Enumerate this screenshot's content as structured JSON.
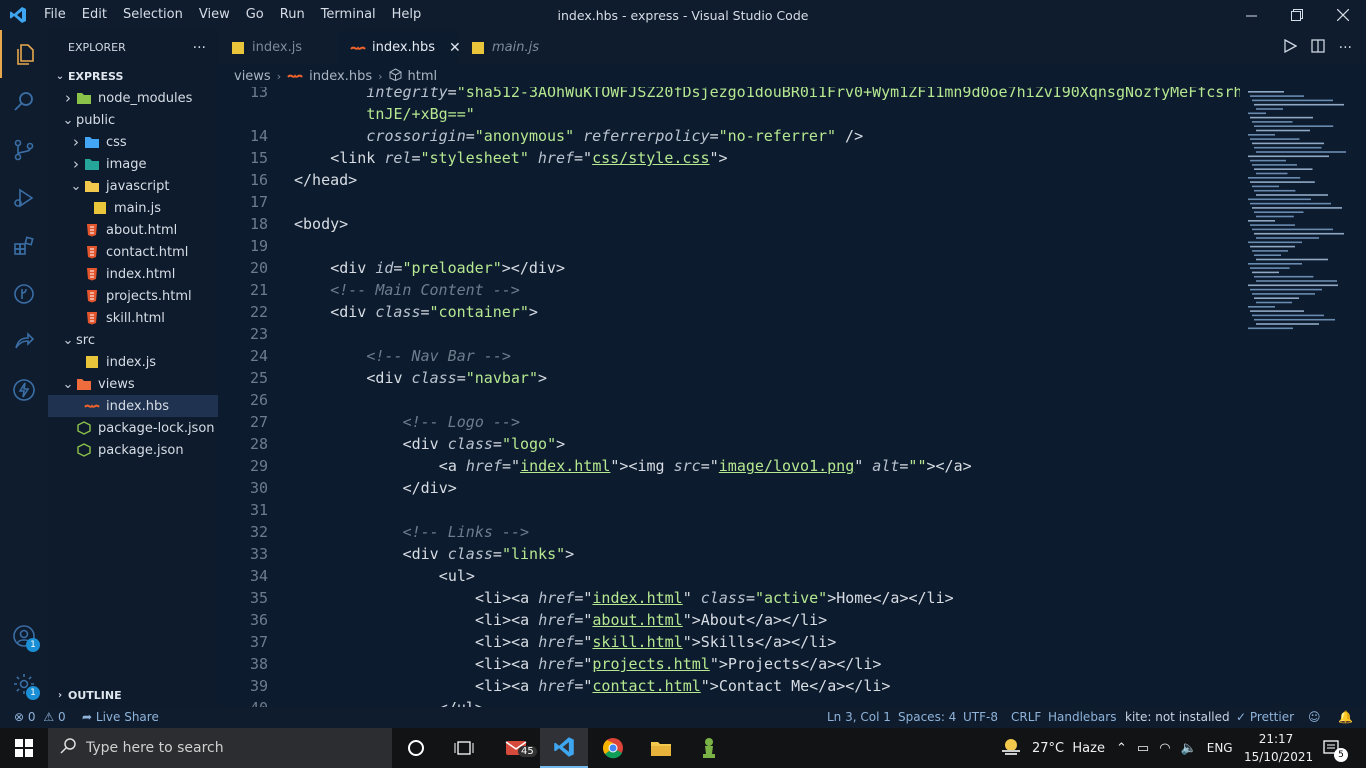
{
  "window": {
    "title": "index.hbs - express - Visual Studio Code",
    "menu": [
      "File",
      "Edit",
      "Selection",
      "View",
      "Go",
      "Run",
      "Terminal",
      "Help"
    ]
  },
  "sidebar": {
    "header": "EXPLORER",
    "more": "···",
    "root": "EXPRESS",
    "outline": "OUTLINE",
    "tree": [
      {
        "label": "node_modules",
        "depth": 1,
        "chevron": "right",
        "icon": "folder-node-icon"
      },
      {
        "label": "public",
        "depth": 1,
        "chevron": "down",
        "icon": "none"
      },
      {
        "label": "css",
        "depth": 2,
        "chevron": "right",
        "icon": "folder-css-icon"
      },
      {
        "label": "image",
        "depth": 2,
        "chevron": "right",
        "icon": "folder-image-icon"
      },
      {
        "label": "javascript",
        "depth": 2,
        "chevron": "down",
        "icon": "folder-js-icon"
      },
      {
        "label": "main.js",
        "depth": 3,
        "chevron": "none",
        "icon": "js-file-icon"
      },
      {
        "label": "about.html",
        "depth": 2,
        "chevron": "none",
        "icon": "html-file-icon"
      },
      {
        "label": "contact.html",
        "depth": 2,
        "chevron": "none",
        "icon": "html-file-icon"
      },
      {
        "label": "index.html",
        "depth": 2,
        "chevron": "none",
        "icon": "html-file-icon"
      },
      {
        "label": "projects.html",
        "depth": 2,
        "chevron": "none",
        "icon": "html-file-icon"
      },
      {
        "label": "skill.html",
        "depth": 2,
        "chevron": "none",
        "icon": "html-file-icon"
      },
      {
        "label": "src",
        "depth": 1,
        "chevron": "down",
        "icon": "none"
      },
      {
        "label": "index.js",
        "depth": 2,
        "chevron": "none",
        "icon": "js-file-icon"
      },
      {
        "label": "views",
        "depth": 1,
        "chevron": "down",
        "icon": "folder-views-icon"
      },
      {
        "label": "index.hbs",
        "depth": 2,
        "chevron": "none",
        "icon": "hbs-file-icon",
        "selected": true
      },
      {
        "label": "package-lock.json",
        "depth": 1,
        "chevron": "none",
        "icon": "node-file-icon"
      },
      {
        "label": "package.json",
        "depth": 1,
        "chevron": "none",
        "icon": "node-file-icon"
      }
    ]
  },
  "tabs": [
    {
      "label": "index.js",
      "icon": "js-file-icon",
      "active": false
    },
    {
      "label": "index.hbs",
      "icon": "hbs-file-icon",
      "active": true,
      "close": "✕"
    },
    {
      "label": "main.js",
      "icon": "js-file-icon",
      "active": false
    }
  ],
  "breadcrumb": [
    "views",
    "index.hbs",
    "html"
  ],
  "code": [
    {
      "n": "13",
      "src": [
        [
          "attr",
          "integrity"
        ],
        [
          "tag",
          "="
        ],
        [
          "str",
          "\"sha512-3AOhWuKTOWFJSZ20fDsjezgo1douBR0i1Frv0+Wym1ZF11mn9d0oe7hiZvI90XqnsgNozfyMeFfcsrh/"
        ]
      ],
      "indent": 8
    },
    {
      "n": "",
      "src": [
        [
          "str",
          "tnJE/+xBg==\""
        ]
      ],
      "indent": 8
    },
    {
      "n": "14",
      "src": [
        [
          "attr",
          "crossorigin"
        ],
        [
          "tag",
          "="
        ],
        [
          "str",
          "\"anonymous\""
        ],
        [
          "tag",
          " "
        ],
        [
          "attr",
          "referrerpolicy"
        ],
        [
          "tag",
          "="
        ],
        [
          "str",
          "\"no-referrer\""
        ],
        [
          "tag",
          " />"
        ]
      ],
      "indent": 8
    },
    {
      "n": "15",
      "src": [
        [
          "tag",
          "<link "
        ],
        [
          "attr",
          "rel"
        ],
        [
          "tag",
          "="
        ],
        [
          "str",
          "\"stylesheet\""
        ],
        [
          "tag",
          " "
        ],
        [
          "attr",
          "href"
        ],
        [
          "tag",
          "=\""
        ],
        [
          "link",
          "css/style.css"
        ],
        [
          "tag",
          "\">"
        ]
      ],
      "indent": 4
    },
    {
      "n": "16",
      "src": [
        [
          "tag",
          "</head>"
        ]
      ],
      "indent": 0
    },
    {
      "n": "17",
      "src": [],
      "indent": 0
    },
    {
      "n": "18",
      "src": [
        [
          "tag",
          "<body>"
        ]
      ],
      "indent": 0
    },
    {
      "n": "19",
      "src": [],
      "indent": 0
    },
    {
      "n": "20",
      "src": [
        [
          "tag",
          "<div "
        ],
        [
          "attr",
          "id"
        ],
        [
          "tag",
          "="
        ],
        [
          "str",
          "\"preloader\""
        ],
        [
          "tag",
          "></div>"
        ]
      ],
      "indent": 4
    },
    {
      "n": "21",
      "src": [
        [
          "com",
          "<!-- Main Content -->"
        ]
      ],
      "indent": 4
    },
    {
      "n": "22",
      "src": [
        [
          "tag",
          "<div "
        ],
        [
          "attr",
          "class"
        ],
        [
          "tag",
          "="
        ],
        [
          "str",
          "\"container\""
        ],
        [
          "tag",
          ">"
        ]
      ],
      "indent": 4
    },
    {
      "n": "23",
      "src": [],
      "indent": 0
    },
    {
      "n": "24",
      "src": [
        [
          "com",
          "<!-- Nav Bar -->"
        ]
      ],
      "indent": 8
    },
    {
      "n": "25",
      "src": [
        [
          "tag",
          "<div "
        ],
        [
          "attr",
          "class"
        ],
        [
          "tag",
          "="
        ],
        [
          "str",
          "\"navbar\""
        ],
        [
          "tag",
          ">"
        ]
      ],
      "indent": 8
    },
    {
      "n": "26",
      "src": [],
      "indent": 0
    },
    {
      "n": "27",
      "src": [
        [
          "com",
          "<!-- Logo -->"
        ]
      ],
      "indent": 12
    },
    {
      "n": "28",
      "src": [
        [
          "tag",
          "<div "
        ],
        [
          "attr",
          "class"
        ],
        [
          "tag",
          "="
        ],
        [
          "str",
          "\"logo\""
        ],
        [
          "tag",
          ">"
        ]
      ],
      "indent": 12
    },
    {
      "n": "29",
      "src": [
        [
          "tag",
          "<a "
        ],
        [
          "attr",
          "href"
        ],
        [
          "tag",
          "=\""
        ],
        [
          "link",
          "index.html"
        ],
        [
          "tag",
          "\"><img "
        ],
        [
          "attr",
          "src"
        ],
        [
          "tag",
          "=\""
        ],
        [
          "link",
          "image/lovo1.png"
        ],
        [
          "tag",
          "\" "
        ],
        [
          "attr",
          "alt"
        ],
        [
          "tag",
          "="
        ],
        [
          "str",
          "\"\""
        ],
        [
          "tag",
          "></a>"
        ]
      ],
      "indent": 16
    },
    {
      "n": "30",
      "src": [
        [
          "tag",
          "</div>"
        ]
      ],
      "indent": 12
    },
    {
      "n": "31",
      "src": [],
      "indent": 0
    },
    {
      "n": "32",
      "src": [
        [
          "com",
          "<!-- Links -->"
        ]
      ],
      "indent": 12
    },
    {
      "n": "33",
      "src": [
        [
          "tag",
          "<div "
        ],
        [
          "attr",
          "class"
        ],
        [
          "tag",
          "="
        ],
        [
          "str",
          "\"links\""
        ],
        [
          "tag",
          ">"
        ]
      ],
      "indent": 12
    },
    {
      "n": "34",
      "src": [
        [
          "tag",
          "<ul>"
        ]
      ],
      "indent": 16
    },
    {
      "n": "35",
      "src": [
        [
          "tag",
          "<li><a "
        ],
        [
          "attr",
          "href"
        ],
        [
          "tag",
          "=\""
        ],
        [
          "link",
          "index.html"
        ],
        [
          "tag",
          "\" "
        ],
        [
          "attr",
          "class"
        ],
        [
          "tag",
          "="
        ],
        [
          "str",
          "\"active\""
        ],
        [
          "tag",
          ">"
        ],
        [
          "txt",
          "Home"
        ],
        [
          "tag",
          "</a></li>"
        ]
      ],
      "indent": 20
    },
    {
      "n": "36",
      "src": [
        [
          "tag",
          "<li><a "
        ],
        [
          "attr",
          "href"
        ],
        [
          "tag",
          "=\""
        ],
        [
          "link",
          "about.html"
        ],
        [
          "tag",
          "\">"
        ],
        [
          "txt",
          "About"
        ],
        [
          "tag",
          "</a></li>"
        ]
      ],
      "indent": 20
    },
    {
      "n": "37",
      "src": [
        [
          "tag",
          "<li><a "
        ],
        [
          "attr",
          "href"
        ],
        [
          "tag",
          "=\""
        ],
        [
          "link",
          "skill.html"
        ],
        [
          "tag",
          "\">"
        ],
        [
          "txt",
          "Skills"
        ],
        [
          "tag",
          "</a></li>"
        ]
      ],
      "indent": 20
    },
    {
      "n": "38",
      "src": [
        [
          "tag",
          "<li><a "
        ],
        [
          "attr",
          "href"
        ],
        [
          "tag",
          "=\""
        ],
        [
          "link",
          "projects.html"
        ],
        [
          "tag",
          "\">"
        ],
        [
          "txt",
          "Projects"
        ],
        [
          "tag",
          "</a></li>"
        ]
      ],
      "indent": 20
    },
    {
      "n": "39",
      "src": [
        [
          "tag",
          "<li><a "
        ],
        [
          "attr",
          "href"
        ],
        [
          "tag",
          "=\""
        ],
        [
          "link",
          "contact.html"
        ],
        [
          "tag",
          "\">"
        ],
        [
          "txt",
          "Contact Me"
        ],
        [
          "tag",
          "</a></li>"
        ]
      ],
      "indent": 20
    },
    {
      "n": "40",
      "src": [
        [
          "tag",
          "</ul>"
        ]
      ],
      "indent": 16
    }
  ],
  "status": {
    "errors": "0",
    "warnings": "0",
    "live_share": "Live Share",
    "position": "Ln 3, Col 1",
    "spaces": "Spaces: 4",
    "encoding": "UTF-8",
    "eol": "CRLF",
    "language": "Handlebars",
    "kite": "kite: not installed",
    "prettier": "Prettier"
  },
  "activity_badges": {
    "accounts": "1",
    "settings": "1"
  },
  "taskbar": {
    "search_placeholder": "Type here to search",
    "mail_badge": "45",
    "weather": "27°C  Haze",
    "language": "ENG",
    "time": "21:17",
    "date": "15/10/2021",
    "notifications": "5"
  }
}
